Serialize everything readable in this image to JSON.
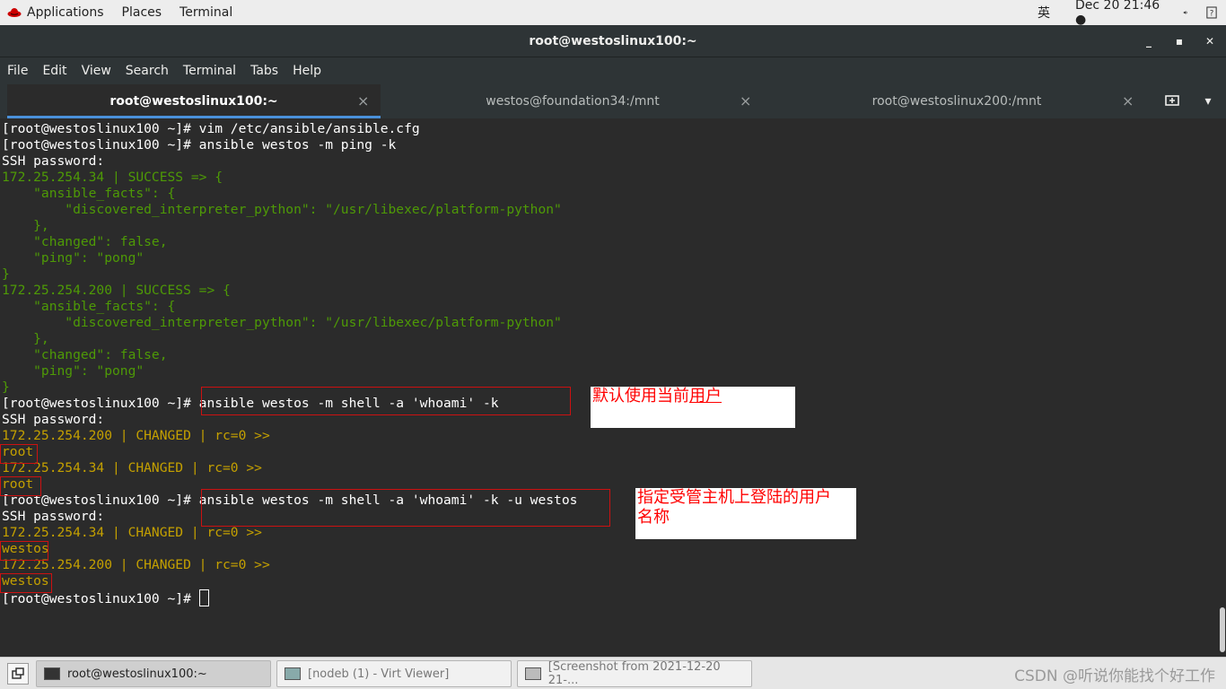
{
  "topbar": {
    "applications": "Applications",
    "places": "Places",
    "terminal": "Terminal",
    "ime": "英",
    "datetime": "Dec 20  21:46 ●",
    "volume_icon": "volume-icon",
    "help_icon": "help-icon",
    "brand_color": "#cc0000"
  },
  "window": {
    "title": "root@westoslinux100:~"
  },
  "menu": [
    "File",
    "Edit",
    "View",
    "Search",
    "Terminal",
    "Tabs",
    "Help"
  ],
  "tabs": [
    {
      "label": "root@westoslinux100:~",
      "active": true
    },
    {
      "label": "westos@foundation34:/mnt",
      "active": false
    },
    {
      "label": "root@westoslinux200:/mnt",
      "active": false
    }
  ],
  "terminal": {
    "lines": [
      {
        "text": "[root@westoslinux100 ~]# vim /etc/ansible/ansible.cfg",
        "color": "w"
      },
      {
        "text": "[root@westoslinux100 ~]# ansible westos -m ping -k",
        "color": "w"
      },
      {
        "text": "SSH password:",
        "color": "w"
      },
      {
        "text": "172.25.254.34 | SUCCESS => {",
        "color": "g"
      },
      {
        "text": "    \"ansible_facts\": {",
        "color": "g"
      },
      {
        "text": "        \"discovered_interpreter_python\": \"/usr/libexec/platform-python\"",
        "color": "g"
      },
      {
        "text": "    },",
        "color": "g"
      },
      {
        "text": "    \"changed\": false,",
        "color": "g"
      },
      {
        "text": "    \"ping\": \"pong\"",
        "color": "g"
      },
      {
        "text": "}",
        "color": "g"
      },
      {
        "text": "172.25.254.200 | SUCCESS => {",
        "color": "g"
      },
      {
        "text": "    \"ansible_facts\": {",
        "color": "g"
      },
      {
        "text": "        \"discovered_interpreter_python\": \"/usr/libexec/platform-python\"",
        "color": "g"
      },
      {
        "text": "    },",
        "color": "g"
      },
      {
        "text": "    \"changed\": false,",
        "color": "g"
      },
      {
        "text": "    \"ping\": \"pong\"",
        "color": "g"
      },
      {
        "text": "}",
        "color": "g"
      },
      {
        "text": "[root@westoslinux100 ~]# ansible westos -m shell -a 'whoami' -k",
        "color": "w"
      },
      {
        "text": "SSH password:",
        "color": "w"
      },
      {
        "text": "172.25.254.200 | CHANGED | rc=0 >>",
        "color": "y"
      },
      {
        "text": "root",
        "color": "y"
      },
      {
        "text": "172.25.254.34 | CHANGED | rc=0 >>",
        "color": "y"
      },
      {
        "text": "root",
        "color": "y"
      },
      {
        "text": "[root@westoslinux100 ~]# ansible westos -m shell -a 'whoami' -k -u westos",
        "color": "w"
      },
      {
        "text": "SSH password:",
        "color": "w"
      },
      {
        "text": "172.25.254.34 | CHANGED | rc=0 >>",
        "color": "y"
      },
      {
        "text": "westos",
        "color": "y"
      },
      {
        "text": "172.25.254.200 | CHANGED | rc=0 >>",
        "color": "y"
      },
      {
        "text": "westos",
        "color": "y"
      }
    ],
    "prompt": "[root@westoslinux100 ~]# "
  },
  "annotations": {
    "note1_a": "默认使用当前",
    "note1_b": "用户",
    "note2_line1": "指定受管主机上登陆的用户",
    "note2_line2": "名称",
    "note_color": "#ff0000"
  },
  "taskbar": {
    "items": [
      {
        "label": "root@westoslinux100:~",
        "active": true
      },
      {
        "label": "[nodeb (1) - Virt Viewer]",
        "active": false
      },
      {
        "label": "[Screenshot from 2021-12-20 21-...",
        "active": false
      }
    ],
    "watermark": "CSDN @听说你能找个好工作"
  }
}
